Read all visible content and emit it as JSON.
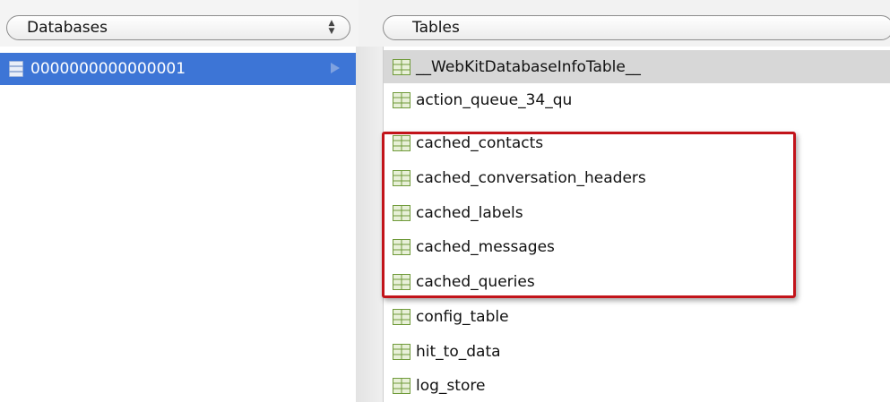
{
  "header": {
    "databases_label": "Databases",
    "tables_label": "Tables"
  },
  "databases": {
    "items": [
      {
        "label": "0000000000000001",
        "selected": true
      }
    ]
  },
  "tables": {
    "items": [
      {
        "label": "__WebKitDatabaseInfoTable__",
        "selected": true
      },
      {
        "label": "action_queue_34_qu"
      },
      {
        "label": "cached_contacts"
      },
      {
        "label": "cached_conversation_headers"
      },
      {
        "label": "cached_labels"
      },
      {
        "label": "cached_messages"
      },
      {
        "label": "cached_queries"
      },
      {
        "label": "config_table"
      },
      {
        "label": "hit_to_data"
      },
      {
        "label": "log_store"
      }
    ]
  },
  "colors": {
    "selection_blue": "#3d75d6",
    "highlight_red": "#c2141a",
    "table_icon_green": "#6f9a3a"
  },
  "icons": {
    "database": "database-icon",
    "table": "table-icon",
    "expand": "chevron-right-icon",
    "stepper": "stepper-icon"
  }
}
